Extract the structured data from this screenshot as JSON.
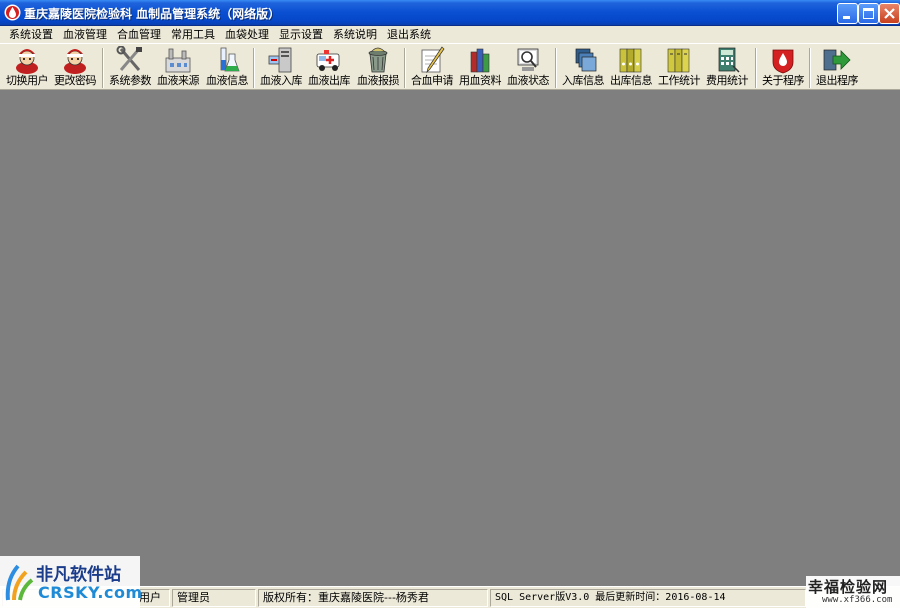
{
  "window": {
    "title": "重庆嘉陵医院检验科 血制品管理系统（网络版）"
  },
  "menu": [
    "系统设置",
    "血液管理",
    "合血管理",
    "常用工具",
    "血袋处理",
    "显示设置",
    "系统说明",
    "退出系统"
  ],
  "toolbar": [
    {
      "label": "切换用户",
      "icon": "user-switch-icon"
    },
    {
      "label": "更改密码",
      "icon": "user-password-icon"
    },
    {
      "label": "系统参数",
      "icon": "tools-icon"
    },
    {
      "label": "血液来源",
      "icon": "factory-icon"
    },
    {
      "label": "血液信息",
      "icon": "flask-icon"
    },
    {
      "label": "血液入库",
      "icon": "computer-in-icon"
    },
    {
      "label": "血液出库",
      "icon": "ambulance-icon"
    },
    {
      "label": "血液报损",
      "icon": "trash-icon"
    },
    {
      "label": "合血申请",
      "icon": "pencil-paper-icon"
    },
    {
      "label": "用血资料",
      "icon": "books-icon"
    },
    {
      "label": "血液状态",
      "icon": "monitor-magnifier-icon"
    },
    {
      "label": "入库信息",
      "icon": "cards-icon"
    },
    {
      "label": "出库信息",
      "icon": "binders-icon"
    },
    {
      "label": "工作统计",
      "icon": "binders-stat-icon"
    },
    {
      "label": "费用统计",
      "icon": "calculator-icon"
    },
    {
      "label": "关于程序",
      "icon": "about-icon"
    },
    {
      "label": "退出程序",
      "icon": "exit-arrow-icon"
    }
  ],
  "status": {
    "user_label": "用户",
    "user_value": "管理员",
    "copyright": "版权所有：重庆嘉陵医院---杨秀君",
    "version": "SQL Server版V3.0  最后更新时间：2016-08-14"
  },
  "watermarks": {
    "left_cn": "非凡软件站",
    "left_en": "CRSKY.com",
    "right_cn": "幸福检验网",
    "right_url": "www.xf366.com"
  },
  "colors": {
    "titlebar": "#0a4fd2",
    "chrome": "#ece9d8",
    "workspace": "#7f7f7f"
  }
}
